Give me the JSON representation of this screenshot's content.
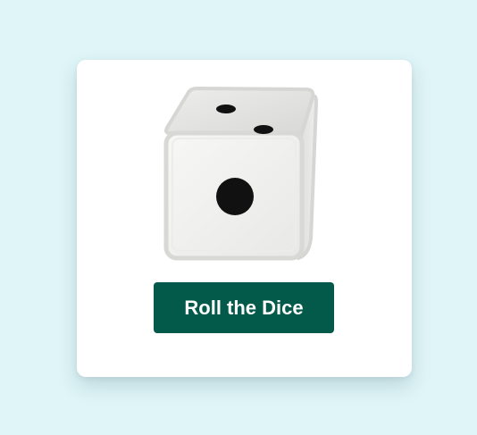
{
  "colors": {
    "page_background": "#dff5f8",
    "card_background": "#ffffff",
    "button_background": "#035a4a",
    "button_text": "#ffffff",
    "pip_color": "#111111"
  },
  "dice": {
    "icon": "dice-icon",
    "front_face_value": 1,
    "top_face_value": 2
  },
  "roll_button": {
    "label": "Roll the Dice"
  }
}
